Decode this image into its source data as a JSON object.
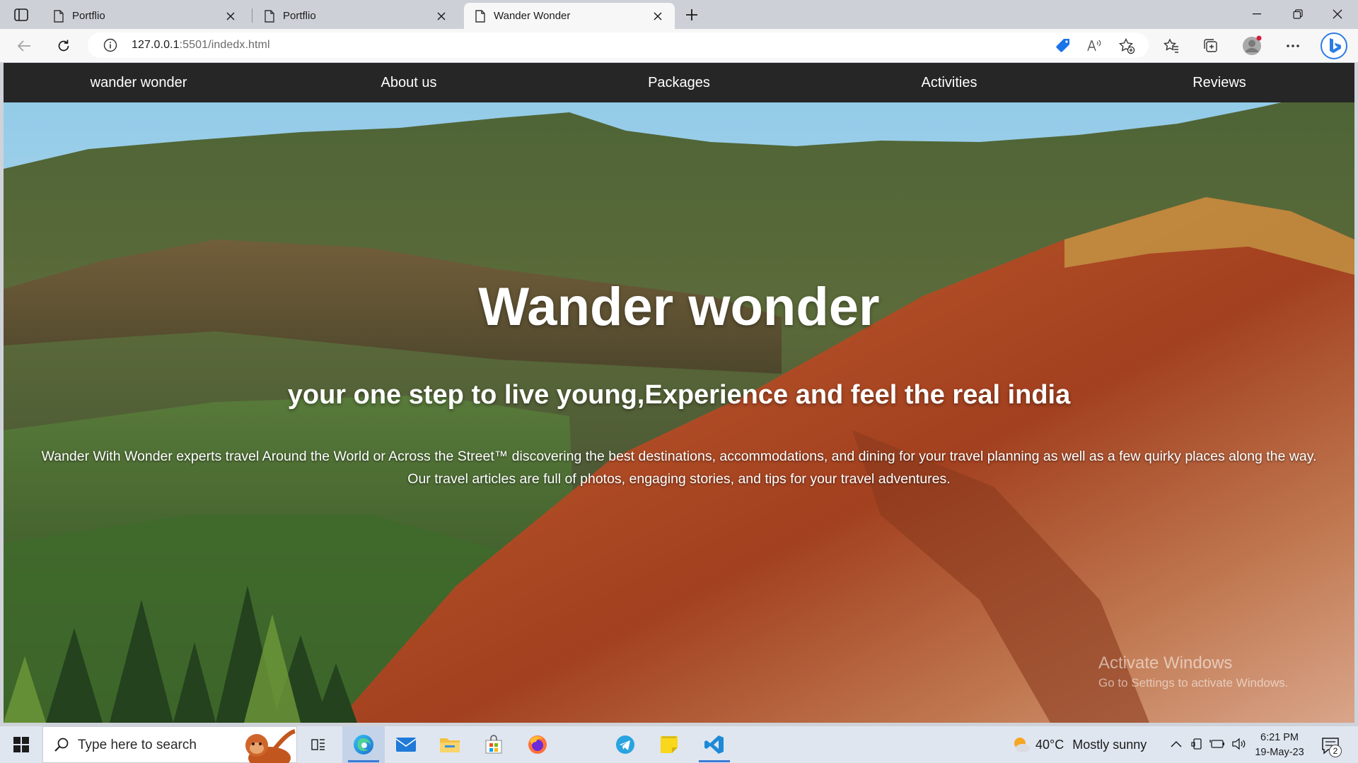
{
  "browser": {
    "tabs": [
      {
        "title": "Portflio",
        "active": false
      },
      {
        "title": "Portflio",
        "active": false
      },
      {
        "title": "Wander Wonder",
        "active": true
      }
    ],
    "address": {
      "host": "127.0.0.1",
      "path": ":5501/indedx.html"
    }
  },
  "site": {
    "nav": [
      "wander wonder",
      "About us",
      "Packages",
      "Activities",
      "Reviews"
    ],
    "hero": {
      "title": "Wander wonder",
      "subtitle": "your one step to live young,Experience and feel the real india",
      "description_line1": "Wander With Wonder experts travel Around the World or Across the Street™ discovering the best destinations, accommodations, and dining for your travel planning as well as a few quirky places along the way.",
      "description_line2": "Our travel articles are full of photos, engaging stories, and tips for your travel adventures."
    }
  },
  "watermark": {
    "line1": "Activate Windows",
    "line2": "Go to Settings to activate Windows."
  },
  "taskbar": {
    "search_placeholder": "Type here to search",
    "weather": {
      "temp": "40°C",
      "condition": "Mostly sunny"
    },
    "clock": {
      "time": "6:21 PM",
      "date": "19-May-23"
    },
    "notification_count": "2",
    "apps": [
      "task-view",
      "edge",
      "mail",
      "file-explorer",
      "microsoft-store",
      "firefox",
      "telegram",
      "sticky-notes",
      "vscode"
    ]
  },
  "colors": {
    "nav_bg": "#262626",
    "tab_strip": "#cdd1d7",
    "taskbar": "#dfe6f0",
    "accent": "#3b7bd6"
  }
}
